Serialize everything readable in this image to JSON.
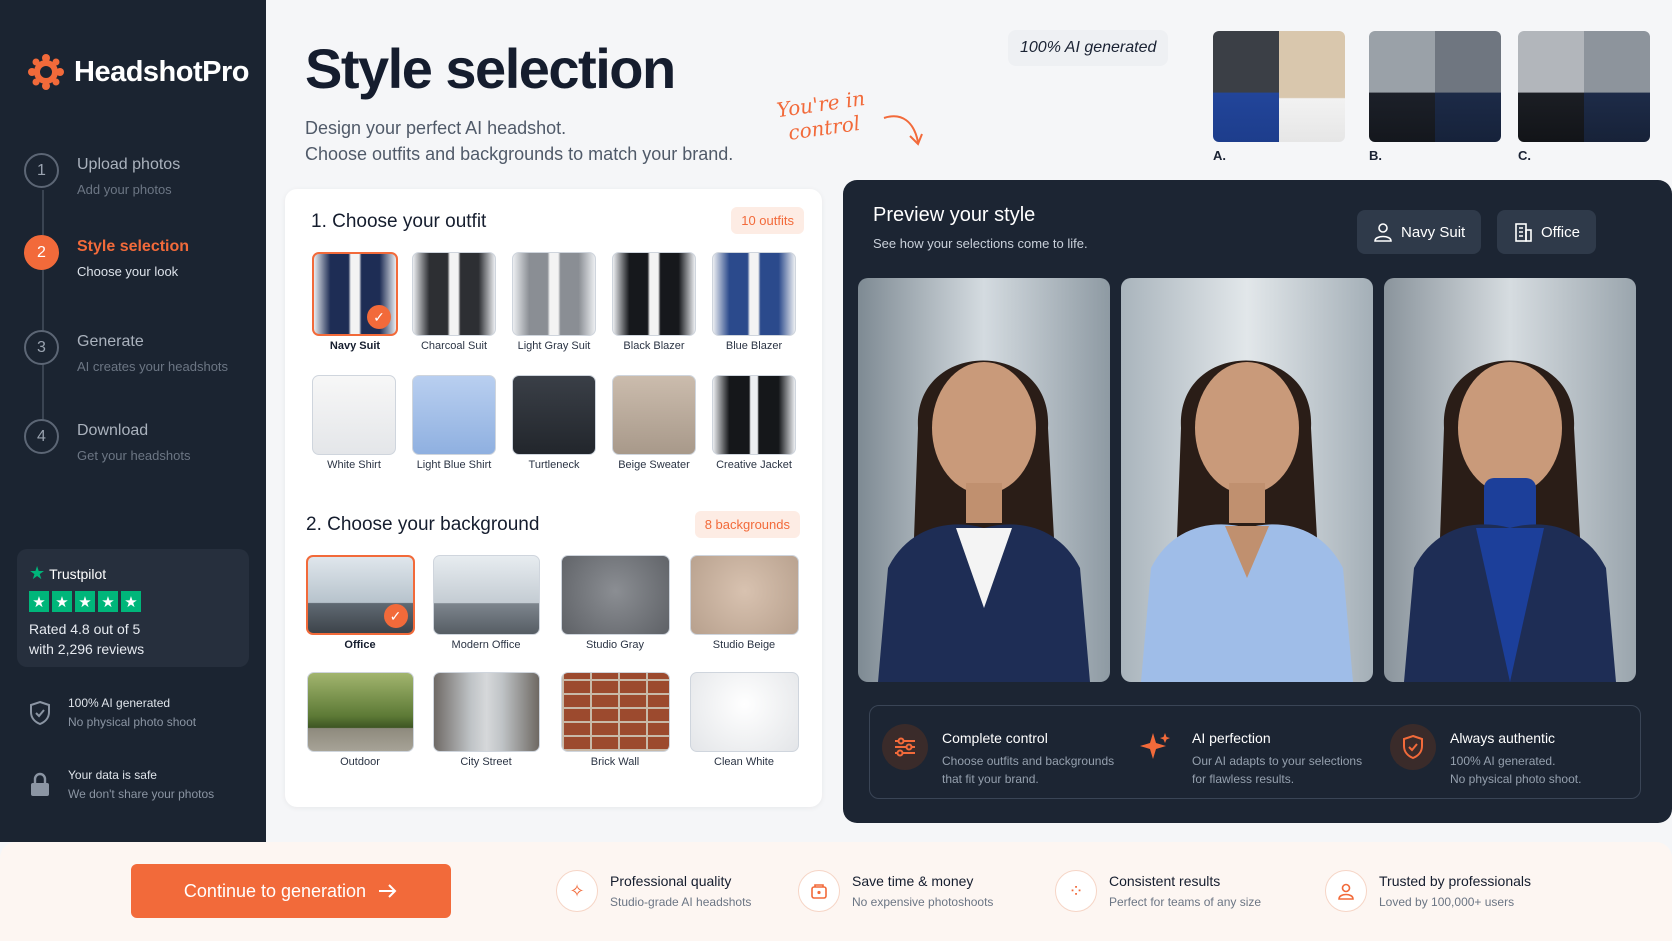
{
  "brand": {
    "name": "HeadshotPro"
  },
  "steps": [
    {
      "num": "1",
      "title": "Upload photos",
      "sub": "Add your photos"
    },
    {
      "num": "2",
      "title": "Style selection",
      "sub": "Choose your look"
    },
    {
      "num": "3",
      "title": "Generate",
      "sub": "AI creates your headshots"
    },
    {
      "num": "4",
      "title": "Download",
      "sub": "Get your headshots"
    }
  ],
  "trustpilot": {
    "name": "Trustpilot",
    "rating_line1": "Rated 4.8 out of 5",
    "rating_line2": "with 2,296 reviews"
  },
  "side_features": [
    {
      "a": "100% AI generated",
      "b": "No physical photo shoot"
    },
    {
      "a": "Your data is safe",
      "b": "We don't share your photos"
    }
  ],
  "header": {
    "title": "Style selection",
    "sub1": "Design your perfect AI headshot.",
    "sub2": "Choose outfits and backgrounds to match your brand.",
    "hand1": "You're in",
    "hand2": "control",
    "badge": "100% AI generated",
    "thumb_labels": [
      "A.",
      "B.",
      "C."
    ]
  },
  "outfits": {
    "title": "1. Choose your outfit",
    "count": "10 outfits",
    "items": [
      "Navy Suit",
      "Charcoal Suit",
      "Light Gray Suit",
      "Black Blazer",
      "Blue Blazer",
      "White Shirt",
      "Light Blue Shirt",
      "Turtleneck",
      "Beige Sweater",
      "Creative Jacket"
    ]
  },
  "backgrounds": {
    "title": "2. Choose your background",
    "count": "8 backgrounds",
    "items": [
      "Office",
      "Modern Office",
      "Studio Gray",
      "Studio Beige",
      "Outdoor",
      "City Street",
      "Brick Wall",
      "Clean White"
    ]
  },
  "preview": {
    "title": "Preview your style",
    "sub": "See how your selections come to life.",
    "chip_outfit": "Navy Suit",
    "chip_bg": "Office",
    "features": [
      {
        "a": "Complete control",
        "b1": "Choose outfits and backgrounds",
        "b2": "that fit your brand."
      },
      {
        "a": "AI perfection",
        "b1": "Our AI adapts to your selections",
        "b2": "for flawless results."
      },
      {
        "a": "Always authentic",
        "b1": "100% AI generated.",
        "b2": "No physical photo shoot."
      }
    ]
  },
  "bottom": {
    "cta": "Continue to generation",
    "items": [
      {
        "a": "Professional quality",
        "b": "Studio-grade AI headshots"
      },
      {
        "a": "Save time & money",
        "b": "No expensive photoshoots"
      },
      {
        "a": "Consistent results",
        "b": "Perfect for teams of any size"
      },
      {
        "a": "Trusted by professionals",
        "b": "Loved by 100,000+ users"
      }
    ]
  },
  "colors": {
    "accent": "#f26a3a",
    "sidebar": "#1b2431",
    "panel": "#1c2533",
    "trustpilot": "#00b67a"
  }
}
